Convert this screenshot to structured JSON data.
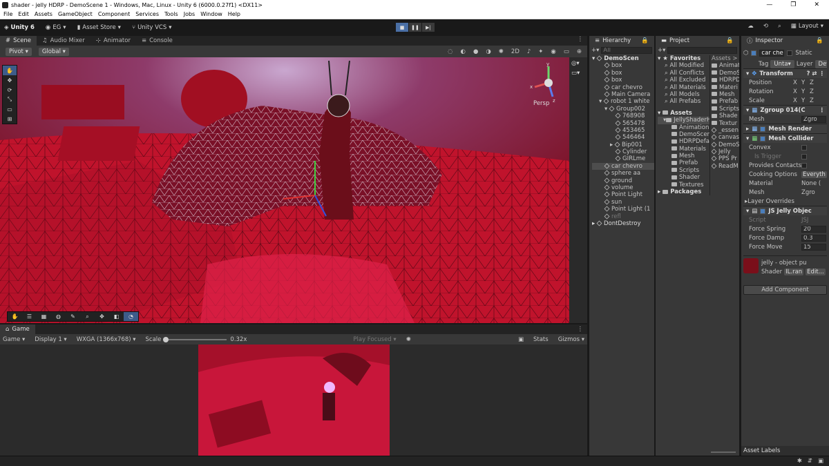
{
  "window": {
    "title": "shader - jelly HDRP - DemoScene 1 - Windows, Mac, Linux - Unity 6 (6000.0.27f1) <DX11>"
  },
  "menu": [
    "File",
    "Edit",
    "Assets",
    "GameObject",
    "Component",
    "Services",
    "Tools",
    "Jobs",
    "Window",
    "Help"
  ],
  "toolbar": {
    "unity_label": "Unity 6",
    "account": "EG",
    "asset_store": "Asset Store",
    "vcs": "Unity VCS",
    "layout": "Layout"
  },
  "scene_tabs": [
    "Scene",
    "Audio Mixer",
    "Animator",
    "Console"
  ],
  "scene_toolbar": {
    "pivot": "Pivot",
    "global": "Global"
  },
  "gizmo": {
    "label": "Persp",
    "axes": [
      "y",
      "x",
      "z"
    ]
  },
  "game": {
    "tab": "Game",
    "mode": "Game",
    "display": "Display 1",
    "resolution": "WXGA (1366x768)",
    "scale_label": "Scale",
    "scale_value": "0.32x",
    "play_focused": "Play Focused",
    "stats": "Stats",
    "gizmos": "Gizmos"
  },
  "hierarchy": {
    "tab": "Hierarchy",
    "search": "All",
    "items": [
      "DemoScen",
      "box",
      "box",
      "box",
      "car chevro",
      "Main Camera",
      "robot 1 white",
      "Group002",
      "768908",
      "565478",
      "453465",
      "546464",
      "Bip001",
      "Cylinder",
      "GIRLme",
      "car chevro",
      "sphere aa",
      "ground",
      "volume",
      "Point Light",
      "sun",
      "Point Light (1",
      "refl",
      "DontDestroy"
    ]
  },
  "project": {
    "tab": "Project",
    "favorites_label": "Favorites",
    "favorites": [
      "All Modified",
      "All Conflicts",
      "All Excluded",
      "All Materials",
      "All Models",
      "All Prefabs"
    ],
    "assets_label": "Assets",
    "assets_tree": [
      "JellyShaderH",
      "Animation",
      "DemoScen",
      "HDRPDefa",
      "Materials",
      "Mesh",
      "Prefab",
      "Scripts",
      "Shader",
      "Textures"
    ],
    "packages_label": "Packages",
    "breadcrumb": "Assets > Je",
    "files": [
      "Animat",
      "DemoS",
      "HDRPD",
      "Materi",
      "Mesh",
      "Prefab",
      "Scripts",
      "Shade",
      "Textur",
      "_essen",
      "canvas",
      "DemoS",
      "Jelly",
      "PPS Pr",
      "ReadM"
    ]
  },
  "inspector": {
    "tab": "Inspector",
    "object_name": "car chevr",
    "static": "Static",
    "tag_label": "Tag",
    "tag_value": "Unta",
    "layer_label": "Layer",
    "layer_value": "Def",
    "transform": {
      "title": "Transform",
      "rows": [
        "Position",
        "Rotation",
        "Scale"
      ],
      "axes": [
        "X",
        "Y",
        "Z"
      ]
    },
    "meshfilter": {
      "title": "Zgroup 014(C",
      "mesh_label": "Mesh",
      "mesh_value": "Zgro"
    },
    "renderer": {
      "title": "Mesh Render"
    },
    "collider": {
      "title": "Mesh Collider",
      "convex": "Convex",
      "trigger": "Is Trigger",
      "contacts": "Provides Contacts",
      "cooking": "Cooking Options",
      "cooking_value": "Everyth",
      "material": "Material",
      "material_value": "None (",
      "mesh": "Mesh",
      "mesh_value": "Zgro",
      "overrides": "Layer Overrides"
    },
    "script": {
      "title": "JS Jelly Objec",
      "script_label": "Script",
      "script_value": "JSJ",
      "spring_label": "Force Spring",
      "spring": "20",
      "damp_label": "Force Damp",
      "damp": "0.3",
      "move_label": "Force Move",
      "move": "15"
    },
    "material": {
      "name": "jelly - object pu",
      "shader_label": "Shader",
      "shader_value": "IL.ran",
      "edit": "Edit..."
    },
    "add_component": "Add Component",
    "asset_labels": "Asset Labels"
  },
  "colors": {
    "accent": "#4a7ebb",
    "panel": "#383838",
    "scene_red": "#b8102a"
  }
}
